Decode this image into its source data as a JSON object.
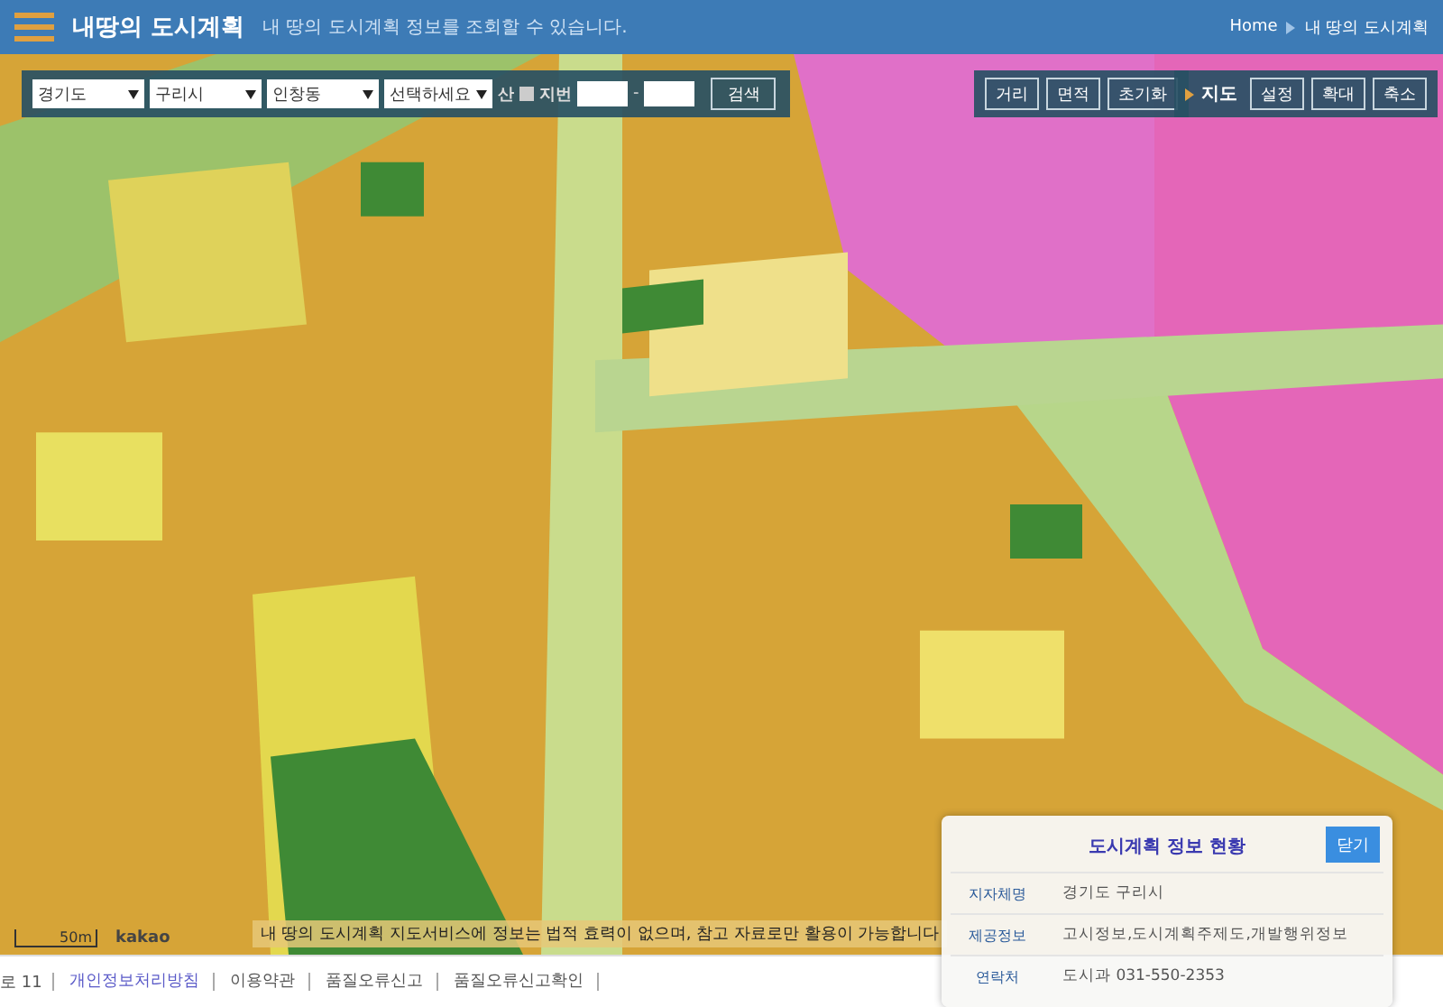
{
  "header": {
    "title": "내땅의 도시계획",
    "subtitle": "내 땅의 도시계획 정보를 조회할 수 있습니다.",
    "breadcrumb": [
      "Home",
      "내 땅의 도시계획"
    ]
  },
  "search": {
    "selects": [
      "경기도",
      "구리시",
      "인창동",
      "선택하세요"
    ],
    "san_label": "산",
    "san_checked": false,
    "jibun_label": "지번",
    "separator": "-",
    "button": "검색"
  },
  "tools": [
    "거리",
    "면적",
    "초기화"
  ],
  "map_controls": {
    "label": "지도",
    "buttons": [
      "설정",
      "확대",
      "축소"
    ]
  },
  "map": {
    "scale": "50m",
    "attribution": "kakao",
    "disclaimer": "내 땅의 도시계획 지도서비스에 정보는 법적 효력이 없으며, 참고 자료로만 활용이 가능합니다"
  },
  "info_panel": {
    "title": "도시계획 정보 현황",
    "close": "닫기",
    "rows": [
      {
        "label": "지자체명",
        "value": "경기도 구리시"
      },
      {
        "label": "제공정보",
        "value": "고시정보,도시계획주제도,개발행위정보"
      },
      {
        "label": "연락처",
        "value": "도시과 031-550-2353"
      }
    ]
  },
  "footer": {
    "lead": "로 11",
    "links": [
      {
        "label": "개인정보처리방침",
        "highlighted": true
      },
      {
        "label": "이용약관",
        "highlighted": false
      },
      {
        "label": "품질오류신고",
        "highlighted": false
      },
      {
        "label": "품질오류신고확인",
        "highlighted": false
      }
    ]
  }
}
